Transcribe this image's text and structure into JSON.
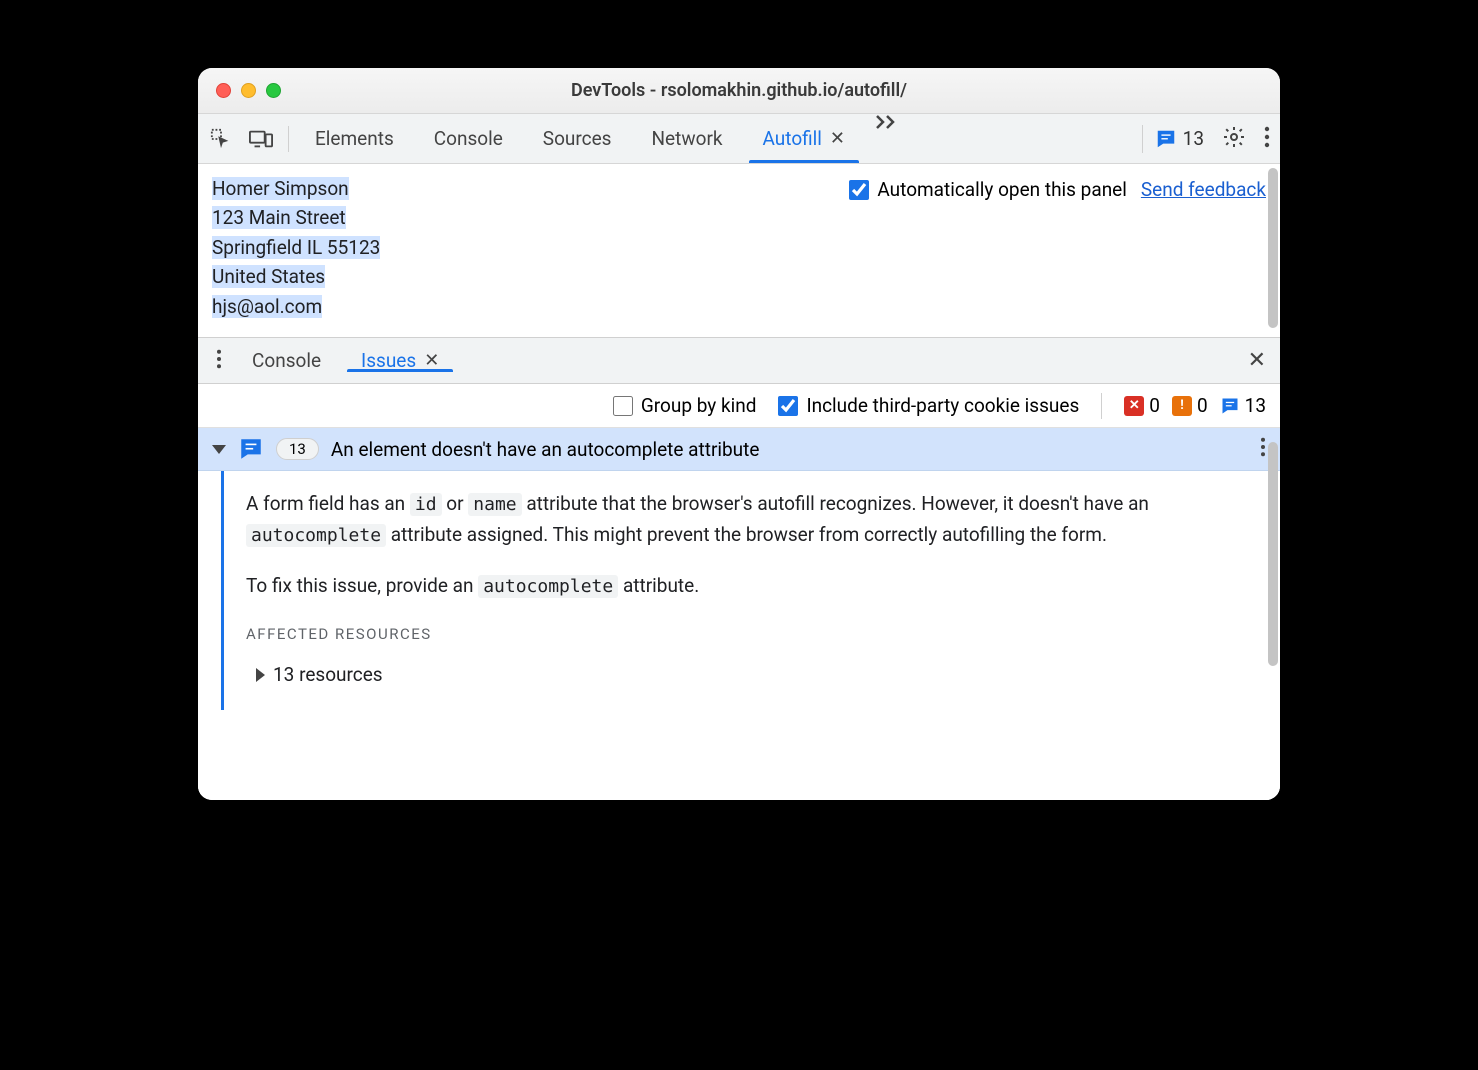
{
  "window": {
    "title": "DevTools - rsolomakhin.github.io/autofill/"
  },
  "toolbar": {
    "tabs": [
      "Elements",
      "Console",
      "Sources",
      "Network",
      "Autofill"
    ],
    "active_tab_index": 4,
    "issue_count": "13"
  },
  "autofill_panel": {
    "address_lines": [
      "Homer Simpson",
      "123 Main Street",
      "Springfield IL 55123",
      "United States",
      "hjs@aol.com"
    ],
    "auto_open_label": "Automatically open this panel",
    "auto_open_checked": true,
    "feedback_link": "Send feedback"
  },
  "drawer": {
    "tabs": [
      "Console",
      "Issues"
    ],
    "active_tab_index": 1,
    "filters": {
      "group_by_kind_label": "Group by kind",
      "group_by_kind_checked": false,
      "third_party_label": "Include third-party cookie issues",
      "third_party_checked": true
    },
    "counts": {
      "errors": "0",
      "warnings": "0",
      "info": "13"
    },
    "issue": {
      "badge_count": "13",
      "title": "An element doesn't have an autocomplete attribute",
      "desc_prefix": "A form field has an ",
      "code_id": "id",
      "desc_mid1": " or ",
      "code_name": "name",
      "desc_mid2": " attribute that the browser's autofill recognizes. However, it doesn't have an ",
      "code_ac1": "autocomplete",
      "desc_suffix": " attribute assigned. This might prevent the browser from correctly autofilling the form.",
      "fix_prefix": "To fix this issue, provide an ",
      "code_ac2": "autocomplete",
      "fix_suffix": " attribute.",
      "affected_label": "AFFECTED RESOURCES",
      "resources_label": "13 resources"
    }
  }
}
